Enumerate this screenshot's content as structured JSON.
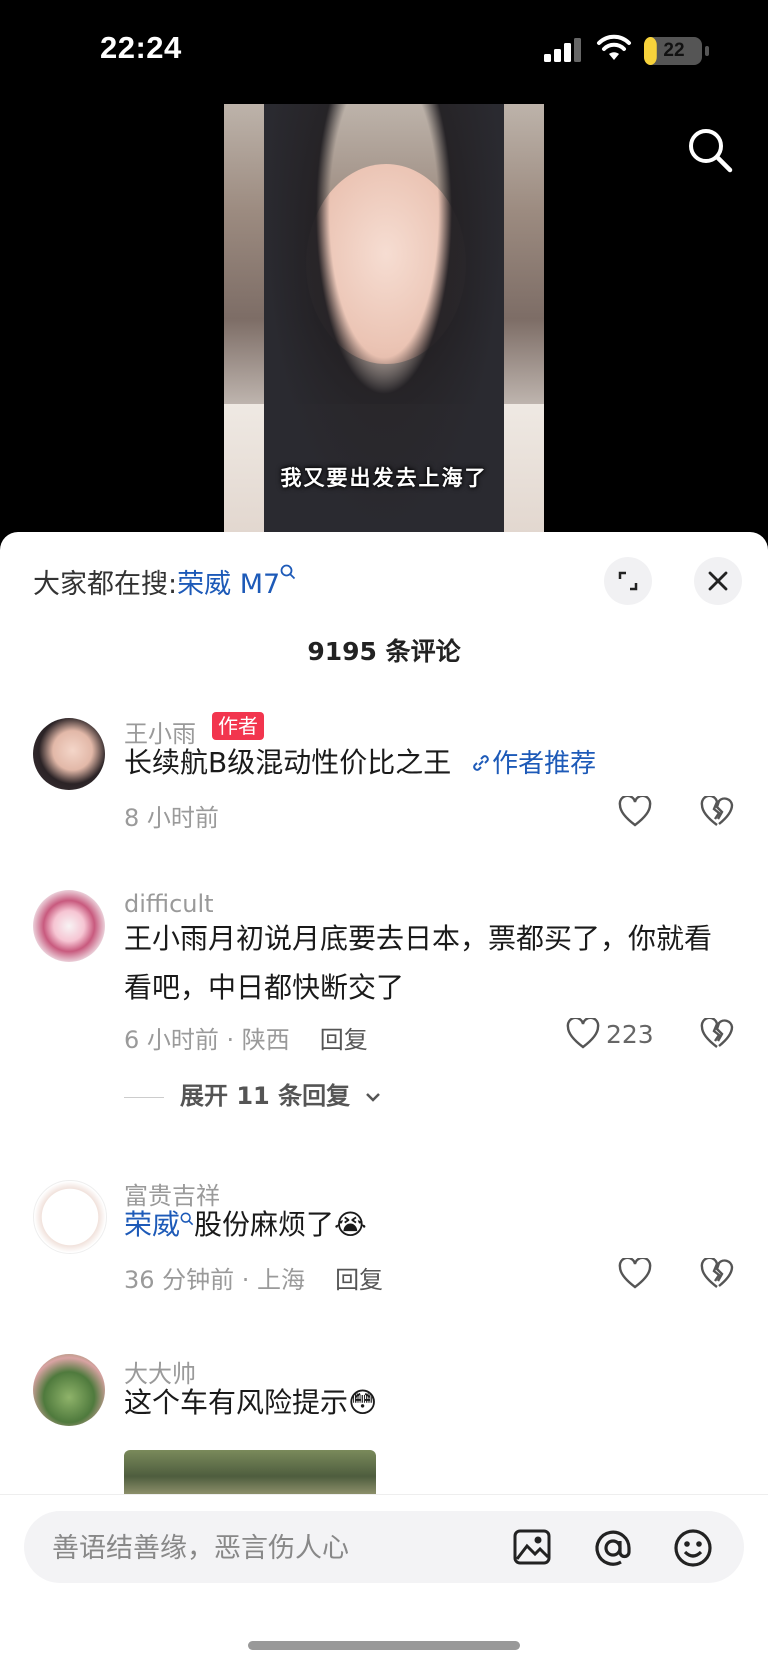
{
  "status_bar": {
    "time": "22:24",
    "battery": "22",
    "battery_level": 0.22
  },
  "video": {
    "caption": "我又要出发去上海了"
  },
  "sheet": {
    "hot_search_prefix": "大家都在搜:",
    "hot_search_keyword": "荣威 M7",
    "comment_count": "9195 条评论"
  },
  "comments": [
    {
      "user": "王小雨",
      "badge": "作者",
      "text": "长续航B级混动性价比之王",
      "recommend": "作者推荐",
      "time": "8 小时前",
      "likes": ""
    },
    {
      "user": "difficult",
      "text": "王小雨月初说月底要去日本，票都买了，你就看看吧，中日都快断交了",
      "time": "6 小时前 · 陕西",
      "reply": "回复",
      "likes": "223",
      "expand": "展开 11 条回复"
    },
    {
      "user": "富贵吉祥",
      "keyword": "荣威",
      "text": "股份麻烦了",
      "emoji": "😭",
      "time": "36 分钟前 · 上海",
      "reply": "回复",
      "likes": ""
    },
    {
      "user": "大大帅",
      "text": "这个车有风险提示",
      "emoji": "😳"
    }
  ],
  "input": {
    "placeholder": "善语结善缘，恶言伤人心"
  },
  "icons": {
    "search": "search-icon",
    "expand": "expand-icon",
    "close": "close-icon",
    "like": "heart-icon",
    "dislike": "broken-heart-icon",
    "image": "image-icon",
    "mention": "at-icon",
    "emoji": "emoji-icon"
  }
}
